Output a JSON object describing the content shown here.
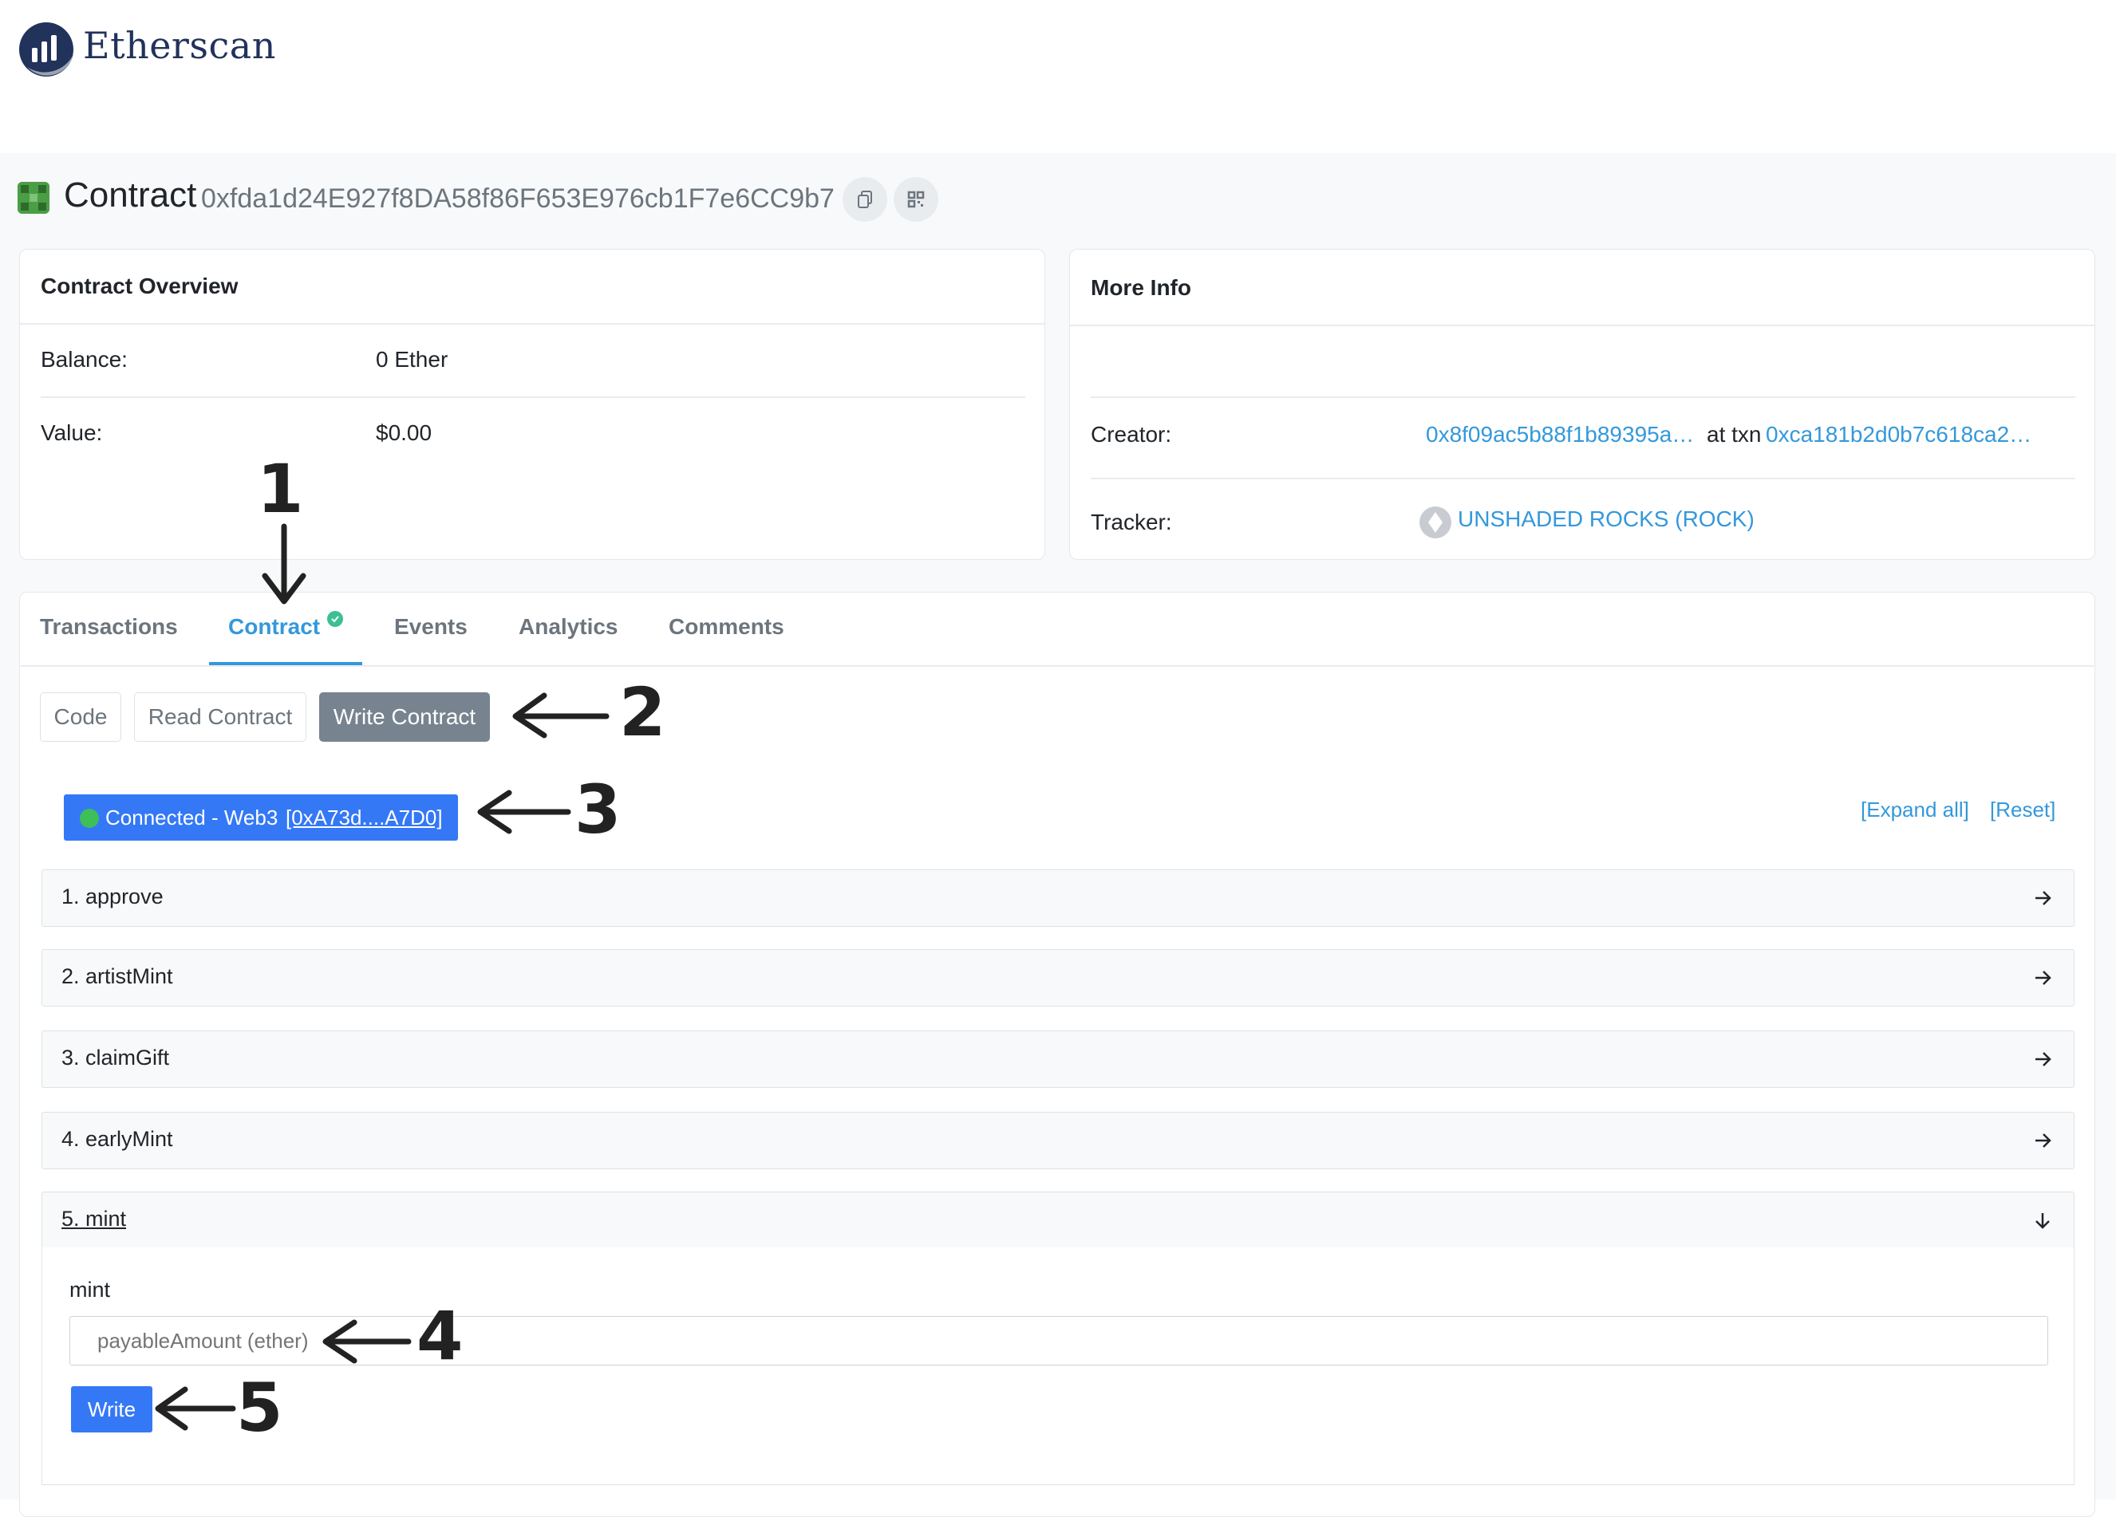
{
  "brand": {
    "name": "Etherscan"
  },
  "contract_header": {
    "label": "Contract",
    "address": "0xfda1d24E927f8DA58f86F653E976cb1F7e6CC9b7"
  },
  "overview": {
    "title": "Contract Overview",
    "balance_label": "Balance:",
    "balance_value": "0 Ether",
    "value_label": "Value:",
    "value_value": "$0.00"
  },
  "more_info": {
    "title": "More Info",
    "creator_label": "Creator:",
    "creator_address": "0x8f09ac5b88f1b89395a…",
    "at_txn_text": "at txn",
    "creator_txn": "0xca181b2d0b7c618ca2…",
    "tracker_label": "Tracker:",
    "tracker_value": "UNSHADED ROCKS (ROCK)"
  },
  "tabs": [
    {
      "label": "Transactions",
      "active": false
    },
    {
      "label": "Contract",
      "active": true
    },
    {
      "label": "Events",
      "active": false
    },
    {
      "label": "Analytics",
      "active": false
    },
    {
      "label": "Comments",
      "active": false
    }
  ],
  "subtabs": [
    {
      "label": "Code",
      "active": false
    },
    {
      "label": "Read Contract",
      "active": false
    },
    {
      "label": "Write Contract",
      "active": true
    }
  ],
  "web3": {
    "status": "Connected - Web3",
    "account": "[0xA73d....A7D0]"
  },
  "links": {
    "expand_all": "[Expand all]",
    "reset": "[Reset]"
  },
  "functions": [
    {
      "label": "1. approve",
      "expanded": false
    },
    {
      "label": "2. artistMint",
      "expanded": false
    },
    {
      "label": "3. claimGift",
      "expanded": false
    },
    {
      "label": "4. earlyMint",
      "expanded": false
    },
    {
      "label": "5. mint",
      "expanded": true
    }
  ],
  "mint_form": {
    "param_label": "mint",
    "input_placeholder": "payableAmount (ether)",
    "write_label": "Write"
  },
  "annotations": [
    "1",
    "2",
    "3",
    "4",
    "5"
  ],
  "colors": {
    "accent": "#3498db",
    "connected_button": "#3478f6",
    "connected_dot": "#3ebf5a",
    "active_subtab": "#77838f",
    "verified_check": "#3dbf95",
    "brand_navy": "#21325b"
  }
}
